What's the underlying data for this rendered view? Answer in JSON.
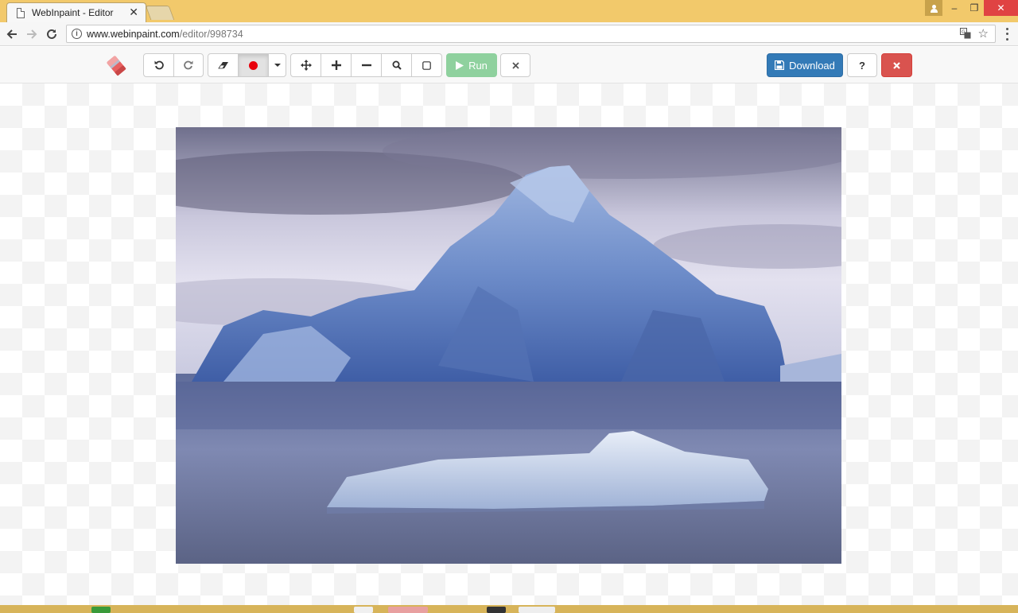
{
  "browser": {
    "tab_title": "WebInpaint - Editor",
    "tab_close": "✕",
    "url_host": "www.webinpaint.com",
    "url_path": "/editor/998734",
    "controls": {
      "minimize": "–",
      "maximize": "❐",
      "close": "✕"
    },
    "icons": [
      "user-icon",
      "back-icon",
      "forward-icon",
      "reload-icon",
      "info-icon",
      "translate-icon",
      "star-icon",
      "menu-icon"
    ]
  },
  "toolbar": {
    "undo_glyph": "↺",
    "redo_glyph": "↻",
    "eraser_glyph": "◢",
    "move_glyph": "✥",
    "zoom_in_glyph": "+",
    "zoom_out_glyph": "−",
    "search_glyph": "⚲",
    "fit_glyph": "▢",
    "run_label": "Run",
    "run_glyph": "▶",
    "clear_glyph": "✕",
    "download_label": "Download",
    "download_glyph": "💾",
    "help_label": "?",
    "close_glyph": "✖",
    "brush_color": "#e8000b"
  },
  "colors": {
    "run_button": "#8fd19e",
    "download_button": "#337ab7",
    "close_button": "#d9534f"
  }
}
